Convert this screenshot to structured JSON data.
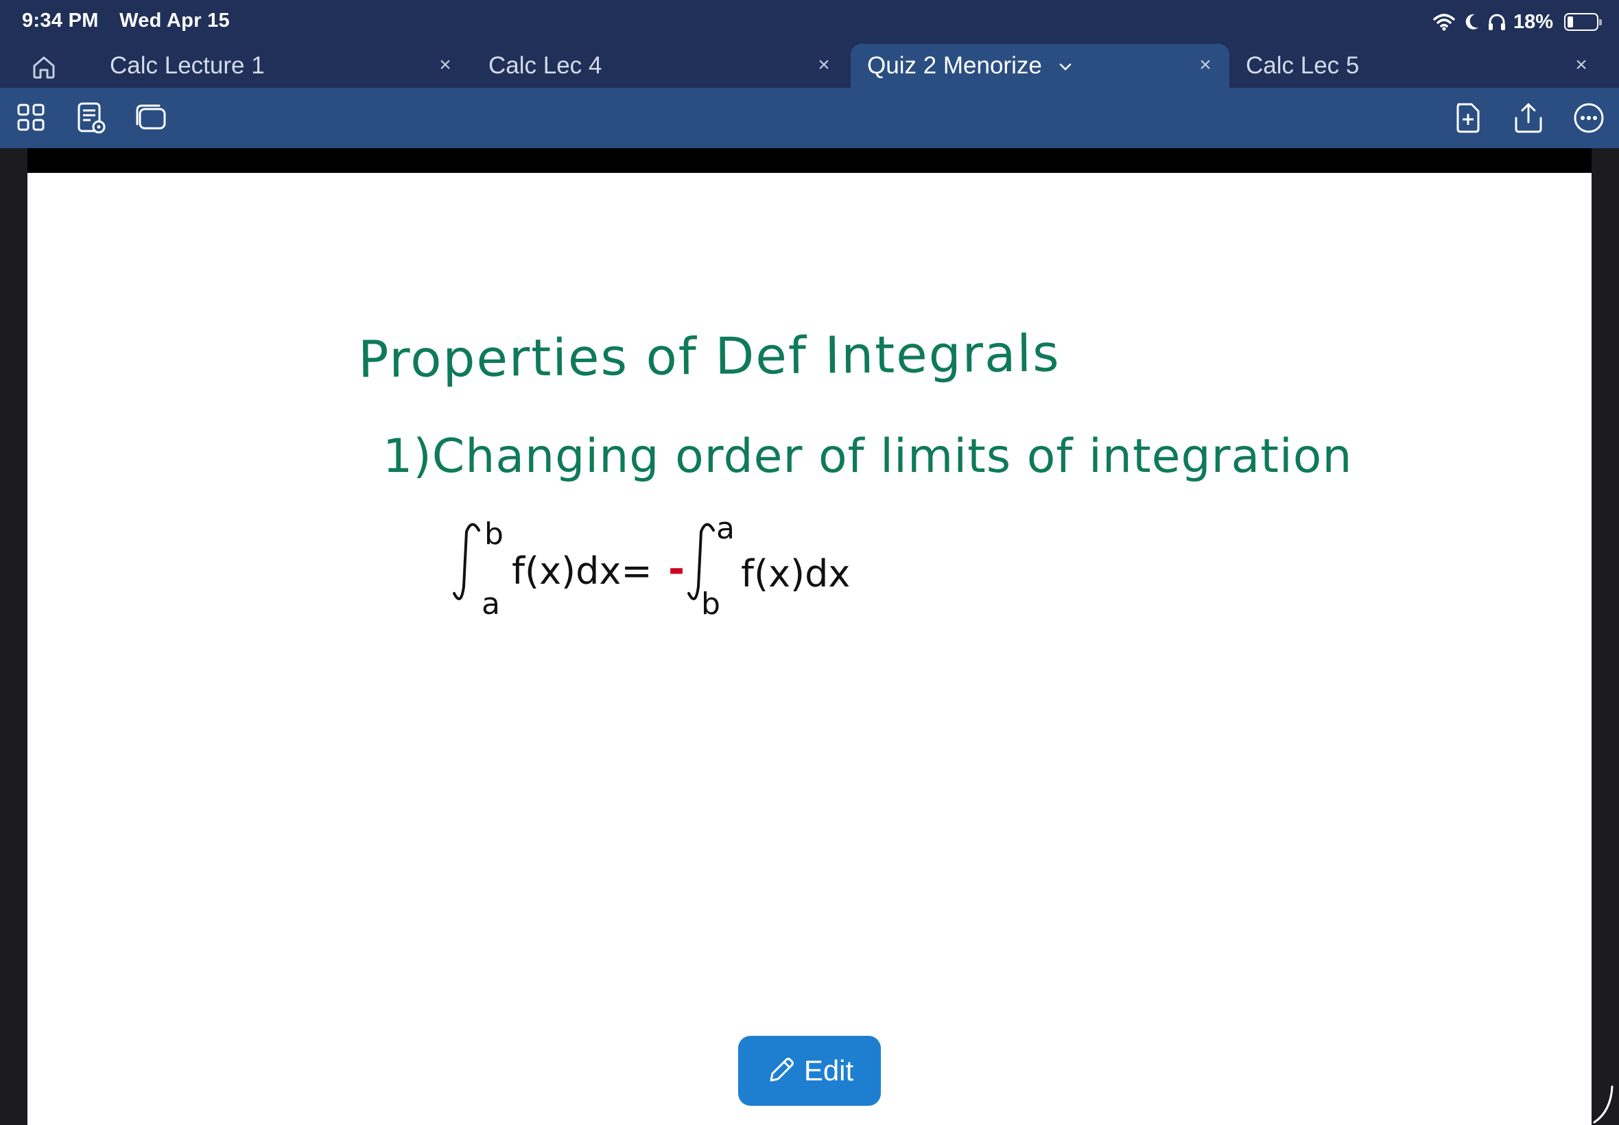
{
  "status_bar": {
    "time": "9:34 PM",
    "date": "Wed Apr 15",
    "battery": "18%",
    "battery_level": 0.18
  },
  "tabs": [
    {
      "label": "Calc Lecture 1",
      "active": false
    },
    {
      "label": "Calc Lec 4",
      "active": false
    },
    {
      "label": "Quiz 2 Menorize",
      "active": true
    },
    {
      "label": "Calc Lec 5",
      "active": false
    }
  ],
  "tab_close_glyph": "×",
  "note": {
    "title": "Properties of Def Integrals",
    "item_1": "1)Changing order of limits of integration",
    "formula": {
      "lhs_lower": "a",
      "lhs_upper": "b",
      "lhs_body": "f(x)dx=",
      "minus": "-",
      "rhs_lower": "b",
      "rhs_upper": "a",
      "rhs_body": "f(x)dx"
    },
    "ink_colors": {
      "green": "#0f7a59",
      "black": "#111111",
      "red": "#d0021b"
    }
  },
  "edit_button": {
    "label": "Edit"
  },
  "colors": {
    "header": "#213058",
    "toolbar": "#2a4e82",
    "edit_button": "#1e7fd1"
  },
  "icons": [
    "home-icon",
    "grid-view-icon",
    "document-view-icon",
    "layers-icon",
    "add-document-icon",
    "share-icon",
    "more-icon",
    "wifi-icon",
    "moon-icon",
    "headphones-icon",
    "pencil-icon"
  ]
}
